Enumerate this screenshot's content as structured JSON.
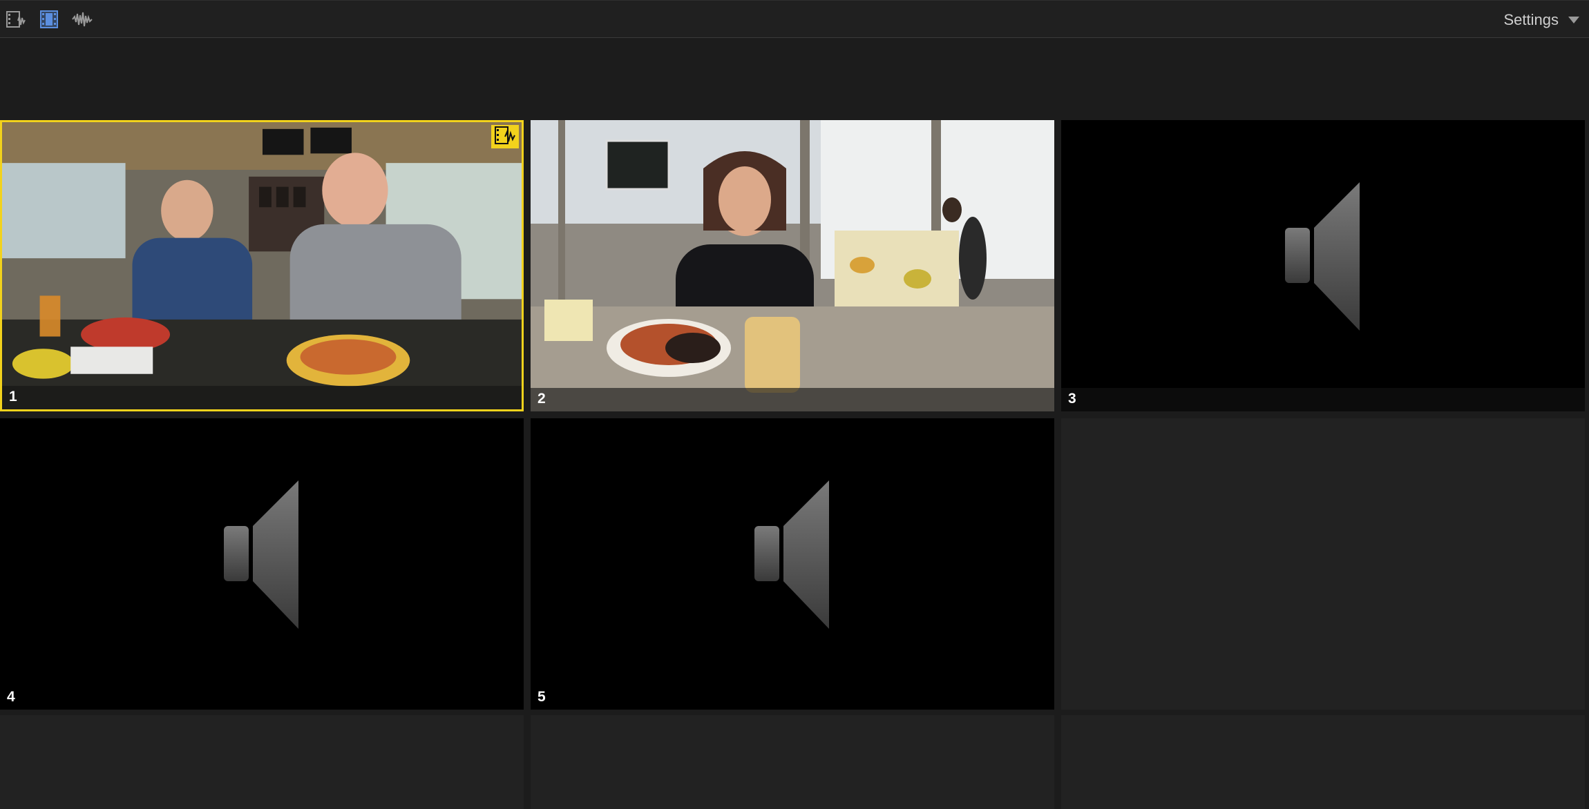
{
  "toolbar": {
    "buttons": [
      {
        "name": "video-audio-icon",
        "active": false
      },
      {
        "name": "video-only-icon",
        "active": true
      },
      {
        "name": "audio-only-icon",
        "active": false
      }
    ],
    "settings_label": "Settings"
  },
  "angles": [
    {
      "number": "1",
      "kind": "video",
      "active": true
    },
    {
      "number": "2",
      "kind": "video",
      "active": false
    },
    {
      "number": "3",
      "kind": "audio",
      "active": false
    },
    {
      "number": "4",
      "kind": "audio",
      "active": false
    },
    {
      "number": "5",
      "kind": "audio",
      "active": false
    }
  ],
  "colors": {
    "active_border": "#f2d21c",
    "active_tool": "#5c8fe0",
    "background": "#1c1c1c"
  }
}
